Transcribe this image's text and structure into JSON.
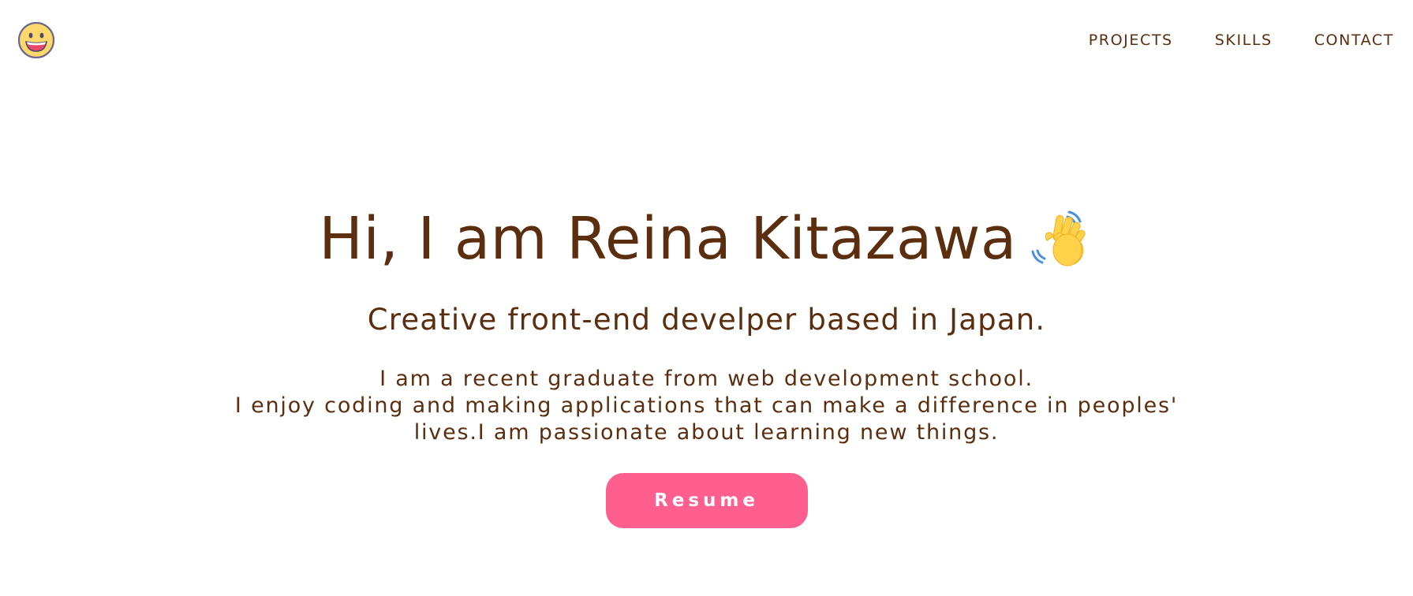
{
  "header": {
    "logo_icon": "grinning-face-icon",
    "nav": [
      {
        "label": "PROJECTS"
      },
      {
        "label": "SKILLS"
      },
      {
        "label": "CONTACT"
      }
    ]
  },
  "hero": {
    "headline": "Hi, I am Reina Kitazawa",
    "headline_icon": "waving-hand-icon",
    "subtitle": "Creative front-end develper based in Japan.",
    "bio_lines": [
      "I am a recent graduate from web development school.",
      "I enjoy coding and making applications that can make a difference in peoples'",
      "lives.I am passionate about learning new things."
    ],
    "resume_label": "Resume"
  },
  "colors": {
    "text": "#5a2e0e",
    "accent": "#ff5f8f",
    "background": "#ffffff"
  }
}
